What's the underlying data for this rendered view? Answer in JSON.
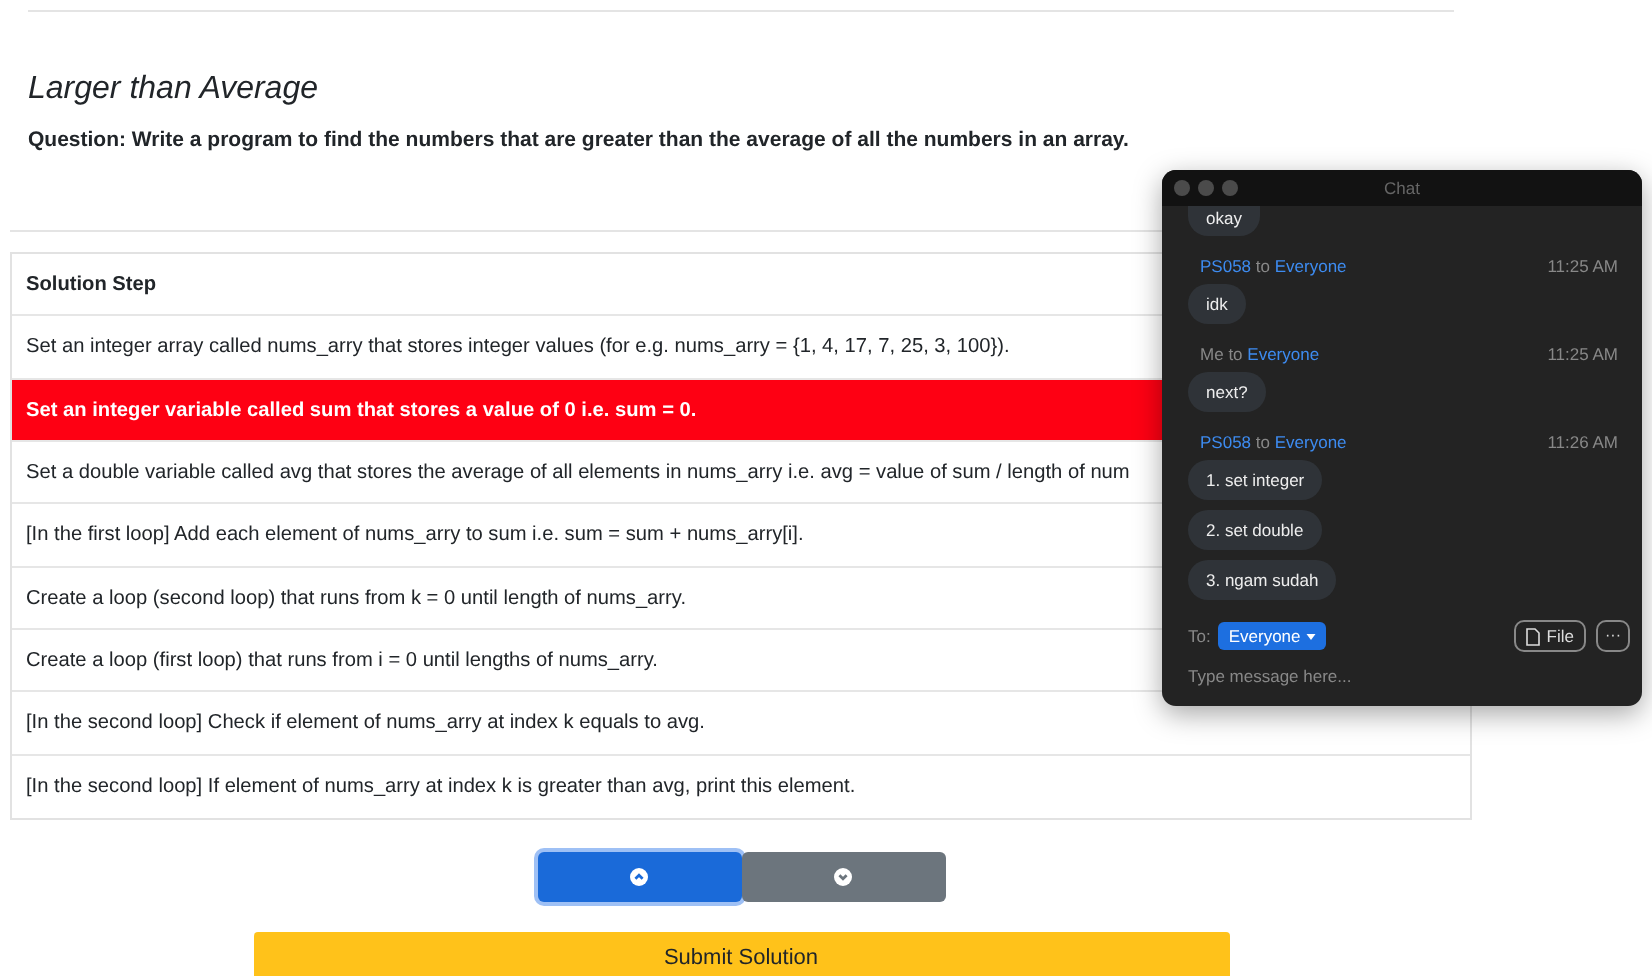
{
  "problem": {
    "title": "Larger than Average",
    "question": "Question: Write a program to find the numbers that are greater than the average of all the numbers in an array."
  },
  "table": {
    "header": "Solution Step",
    "rows": [
      {
        "text": "Set an integer array called nums_arry that stores integer values (for e.g. nums_arry = {1, 4, 17, 7, 25, 3, 100}).",
        "selected": false
      },
      {
        "text": "Set an integer variable called sum that stores a value of 0 i.e. sum = 0.",
        "selected": true
      },
      {
        "text": "Set a double variable called avg that stores the average of all elements in nums_arry i.e. avg = value of sum / length of num",
        "selected": false
      },
      {
        "text": "[In the first loop] Add each element of nums_arry to sum i.e. sum = sum + nums_arry[i].",
        "selected": false
      },
      {
        "text": "Create a loop (second loop) that runs from k = 0 until length of nums_arry.",
        "selected": false
      },
      {
        "text": "Create a loop (first loop) that runs from i = 0 until lengths of nums_arry.",
        "selected": false
      },
      {
        "text": "[In the second loop] Check if element of nums_arry at index k equals to avg.",
        "selected": false
      },
      {
        "text": "[In the second loop] If element of nums_arry at index k is greater than avg, print this element.",
        "selected": false
      }
    ]
  },
  "move_buttons": [
    {
      "kind": "up",
      "focused": true
    },
    {
      "kind": "down",
      "focused": false
    }
  ],
  "submit_button": "Submit Solution",
  "chat": {
    "title": "Chat",
    "messages": [
      {
        "bubbles": [
          "okay"
        ]
      },
      {
        "sender": "PS058",
        "is_me": false,
        "to": "to",
        "recipient": "Everyone",
        "time": "11:25 AM",
        "bubbles": [
          "idk"
        ]
      },
      {
        "sender": "Me",
        "is_me": true,
        "to": "to",
        "recipient": "Everyone",
        "time": "11:25 AM",
        "bubbles": [
          "next?"
        ]
      },
      {
        "sender": "PS058",
        "is_me": false,
        "to": "to",
        "recipient": "Everyone",
        "time": "11:26 AM",
        "bubbles": [
          "1. set integer",
          "2. set double",
          "3. ngam sudah"
        ]
      }
    ],
    "to_label": "To:",
    "recipient": "Everyone",
    "file_button": "File",
    "more_button": "···",
    "placeholder": "Type message here..."
  }
}
